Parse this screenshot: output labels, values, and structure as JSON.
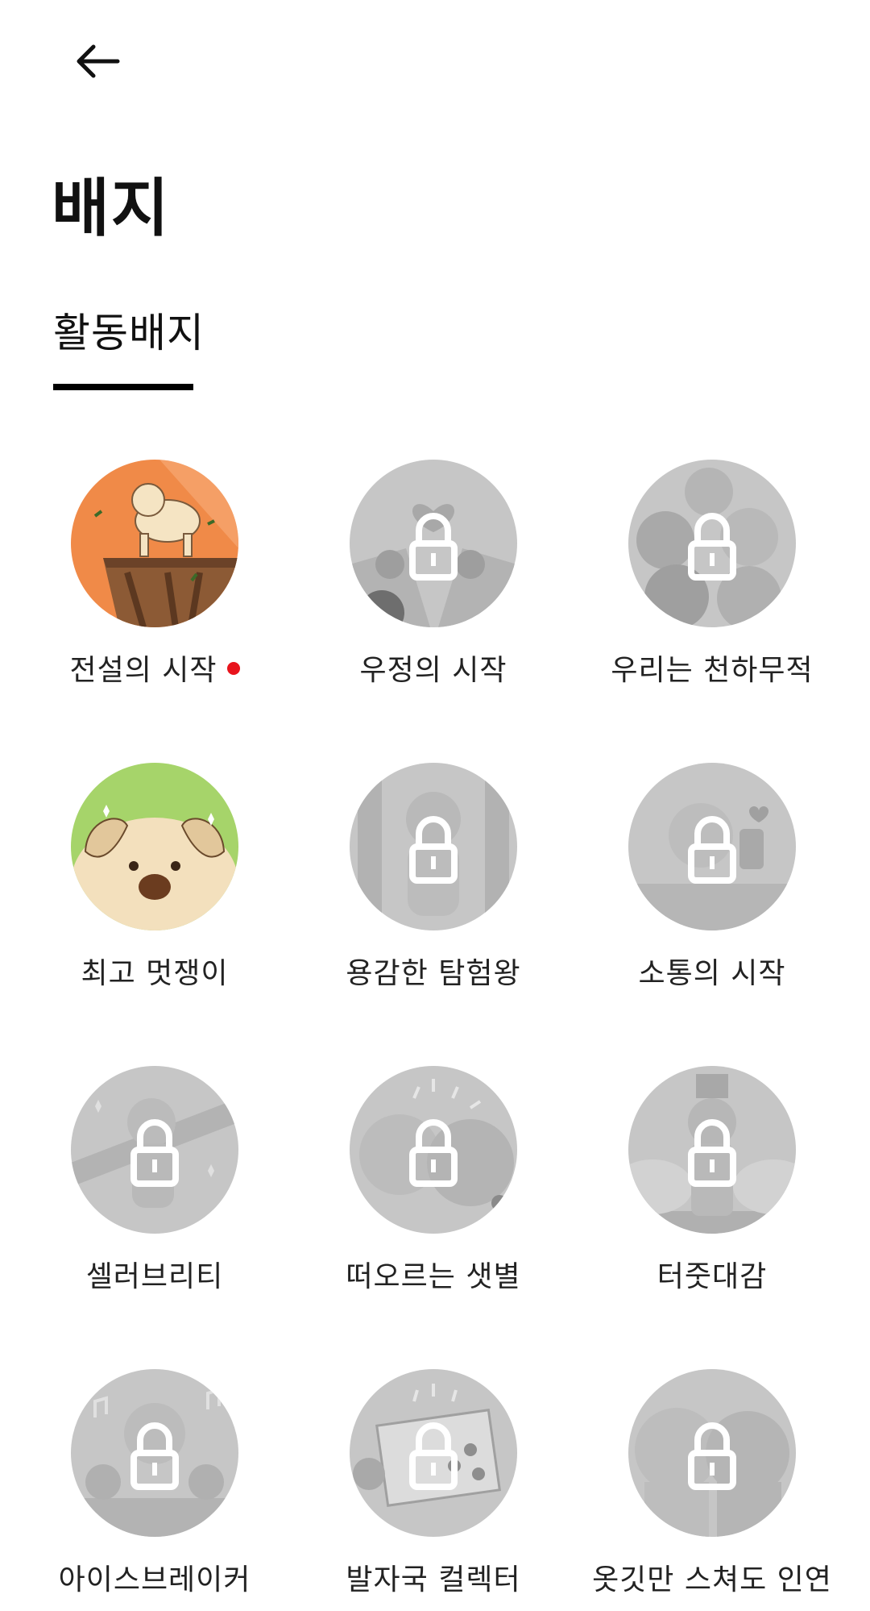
{
  "header": {
    "back_icon": "arrow-left-icon"
  },
  "page": {
    "title": "배지"
  },
  "tabs": [
    {
      "label": "활동배지",
      "active": true
    }
  ],
  "colors": {
    "locked": "#c4c4c4",
    "accent_orange": "#f08a48",
    "accent_green": "#a6d46a",
    "new_dot": "#e8141c"
  },
  "badges": [
    {
      "label": "전설의 시작",
      "unlocked": true,
      "new": true
    },
    {
      "label": "우정의 시작",
      "unlocked": false
    },
    {
      "label": "우리는 천하무적",
      "unlocked": false
    },
    {
      "label": "최고 멋쟁이",
      "unlocked": true
    },
    {
      "label": "용감한 탐험왕",
      "unlocked": false
    },
    {
      "label": "소통의 시작",
      "unlocked": false
    },
    {
      "label": "셀러브리티",
      "unlocked": false
    },
    {
      "label": "떠오르는 샛별",
      "unlocked": false
    },
    {
      "label": "터줏대감",
      "unlocked": false
    },
    {
      "label": "아이스브레이커",
      "unlocked": false
    },
    {
      "label": "발자국 컬렉터",
      "unlocked": false
    },
    {
      "label": "옷깃만 스쳐도 인연",
      "unlocked": false
    }
  ]
}
